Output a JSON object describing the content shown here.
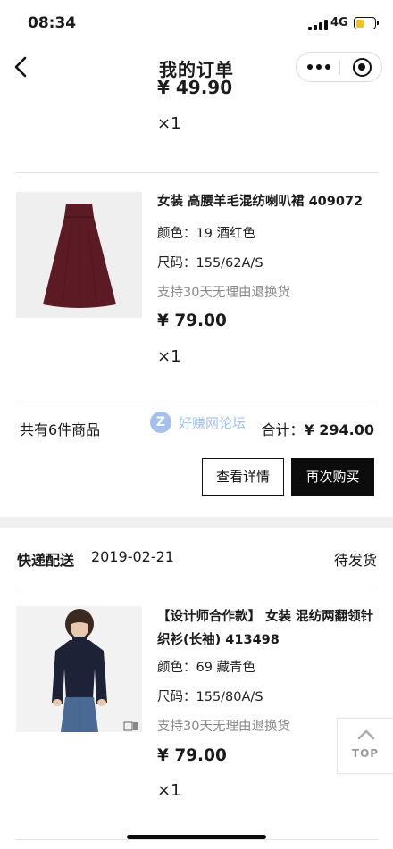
{
  "status_bar": {
    "time": "08:34",
    "network": "4G",
    "battery_level": 0.45
  },
  "nav": {
    "title": "我的订单"
  },
  "prev_item": {
    "cut_price": "¥ 49.90",
    "qty": "×1"
  },
  "order1": {
    "item": {
      "name": "女装 高腰羊毛混纺喇叭裙 409072",
      "color": "颜色：19 酒红色",
      "size": "尺码：155/62A/S",
      "note": "支持30天无理由退换货",
      "price": "¥ 79.00",
      "qty": "×1"
    },
    "summary": {
      "count": "共有6件商品",
      "total_label": "合计：",
      "total": "¥ 294.00"
    },
    "buttons": {
      "details": "查看详情",
      "rebuy": "再次购买"
    }
  },
  "watermark": {
    "logo": "Z",
    "text": "好赚网论坛"
  },
  "order2": {
    "shipping": {
      "method": "快递配送",
      "date": "2019-02-21",
      "status": "待发货"
    },
    "item": {
      "name": "【设计师合作款】 女装 混纺两翻领针织衫(长袖) 413498",
      "color": "颜色：69 藏青色",
      "size": "尺码：155/80A/S",
      "note": "支持30天无理由退换货",
      "price": "¥ 79.00",
      "qty": "×1"
    }
  },
  "top_button": {
    "label": "TOP"
  }
}
